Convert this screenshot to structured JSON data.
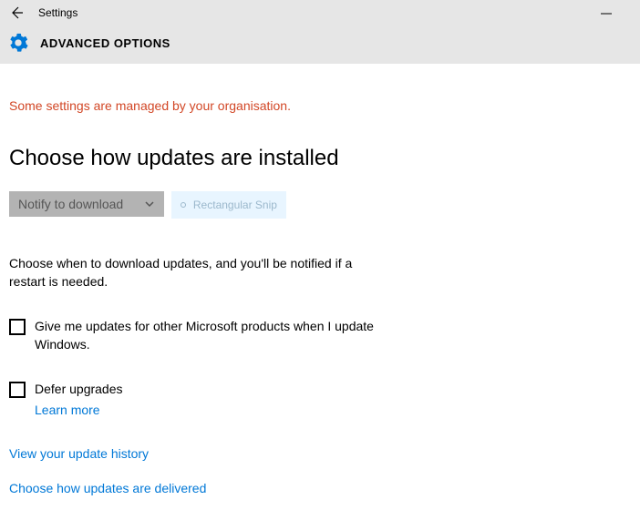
{
  "titlebar": {
    "window_title": "Settings"
  },
  "subheader": {
    "title": "ADVANCED OPTIONS"
  },
  "main": {
    "org_notice": "Some settings are managed by your organisation.",
    "section_heading": "Choose how updates are installed",
    "dropdown": {
      "selected": "Notify to download"
    },
    "snip_label": "Rectangular Snip",
    "help_text": "Choose when to download updates, and you'll be notified if a restart is needed.",
    "checkbox1_label": "Give me updates for other Microsoft products when I update Windows.",
    "checkbox2_label": "Defer upgrades",
    "learn_more": "Learn more",
    "history_link": "View your update history",
    "delivery_link": "Choose how updates are delivered"
  }
}
